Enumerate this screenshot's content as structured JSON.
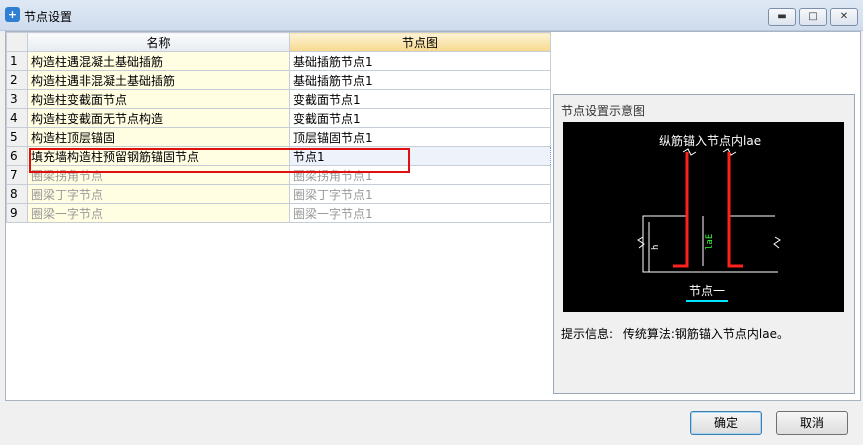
{
  "window": {
    "title": "节点设置",
    "controls": [
      "minimize-icon",
      "maximize-icon",
      "close-icon"
    ]
  },
  "grid": {
    "columns": [
      "名称",
      "节点图"
    ],
    "rows": [
      {
        "index": "1",
        "name": "构造柱遇混凝土基础插筋",
        "node": "基础插筋节点1"
      },
      {
        "index": "2",
        "name": "构造柱遇非混凝土基础插筋",
        "node": "基础插筋节点1"
      },
      {
        "index": "3",
        "name": "构造柱变截面节点",
        "node": "变截面节点1"
      },
      {
        "index": "4",
        "name": "构造柱变截面无节点构造",
        "node": "变截面节点1"
      },
      {
        "index": "5",
        "name": "构造柱顶层锚固",
        "node": "顶层锚固节点1"
      },
      {
        "index": "6",
        "name": "填充墙构造柱预留钢筋锚固节点",
        "node": "节点1"
      },
      {
        "index": "7",
        "name": "圈梁拐角节点",
        "node": "圈梁拐角节点1"
      },
      {
        "index": "8",
        "name": "圈梁丁字节点",
        "node": "圈梁丁字节点1"
      },
      {
        "index": "9",
        "name": "圈梁一字节点",
        "node": "圈梁一字节点1"
      }
    ],
    "selected_row": 6
  },
  "preview": {
    "title": "节点设置示意图",
    "diagram_caption": "纵筋锚入节点内lae",
    "diagram_label": "节点一",
    "dim_h": "h",
    "dim_lae": "laE"
  },
  "hint": {
    "label": "提示信息:",
    "text": "传统算法:钢筋锚入节点内lae。"
  },
  "buttons": {
    "ok": "确定",
    "cancel": "取消"
  },
  "colors": {
    "selection_box": "#e01010",
    "node_header": "#f6d98d",
    "name_cell": "#fffde2",
    "diagram_bg": "#000000",
    "rebar": "#ff2020",
    "label_underline": "#00e5ff"
  }
}
